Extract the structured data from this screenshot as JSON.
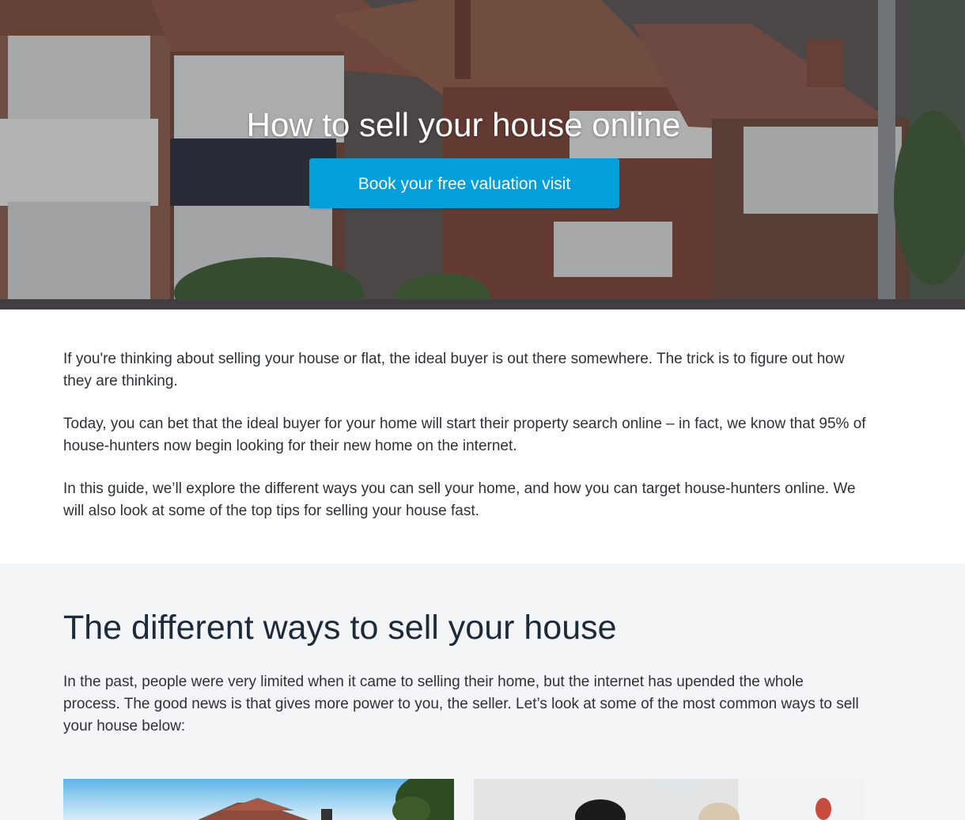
{
  "hero": {
    "title": "How to sell your house online",
    "cta_label": "Book your free valuation visit",
    "cta_color": "#039fdb"
  },
  "intro": {
    "paragraphs": [
      "If you're thinking about selling your house or flat, the ideal buyer is out there somewhere. The trick is to figure out how they are thinking.",
      "Today, you can bet that the ideal buyer for your home will start their property search online – in fact, we know that 95% of house-hunters now begin looking for their new home on the internet.",
      "In this guide, we’ll explore the different ways you can sell your home, and how you can target house-hunters online. We will also look at some of the top tips for selling your house fast."
    ]
  },
  "ways_section": {
    "title": "The different ways to sell your house",
    "text": "In the past, people were very limited when it came to selling their home, but the internet has upended the whole process. The good news is that gives more power to you, the seller. Let’s look at some of the most common ways to sell your house below:",
    "background_color": "#f4f5f6"
  }
}
